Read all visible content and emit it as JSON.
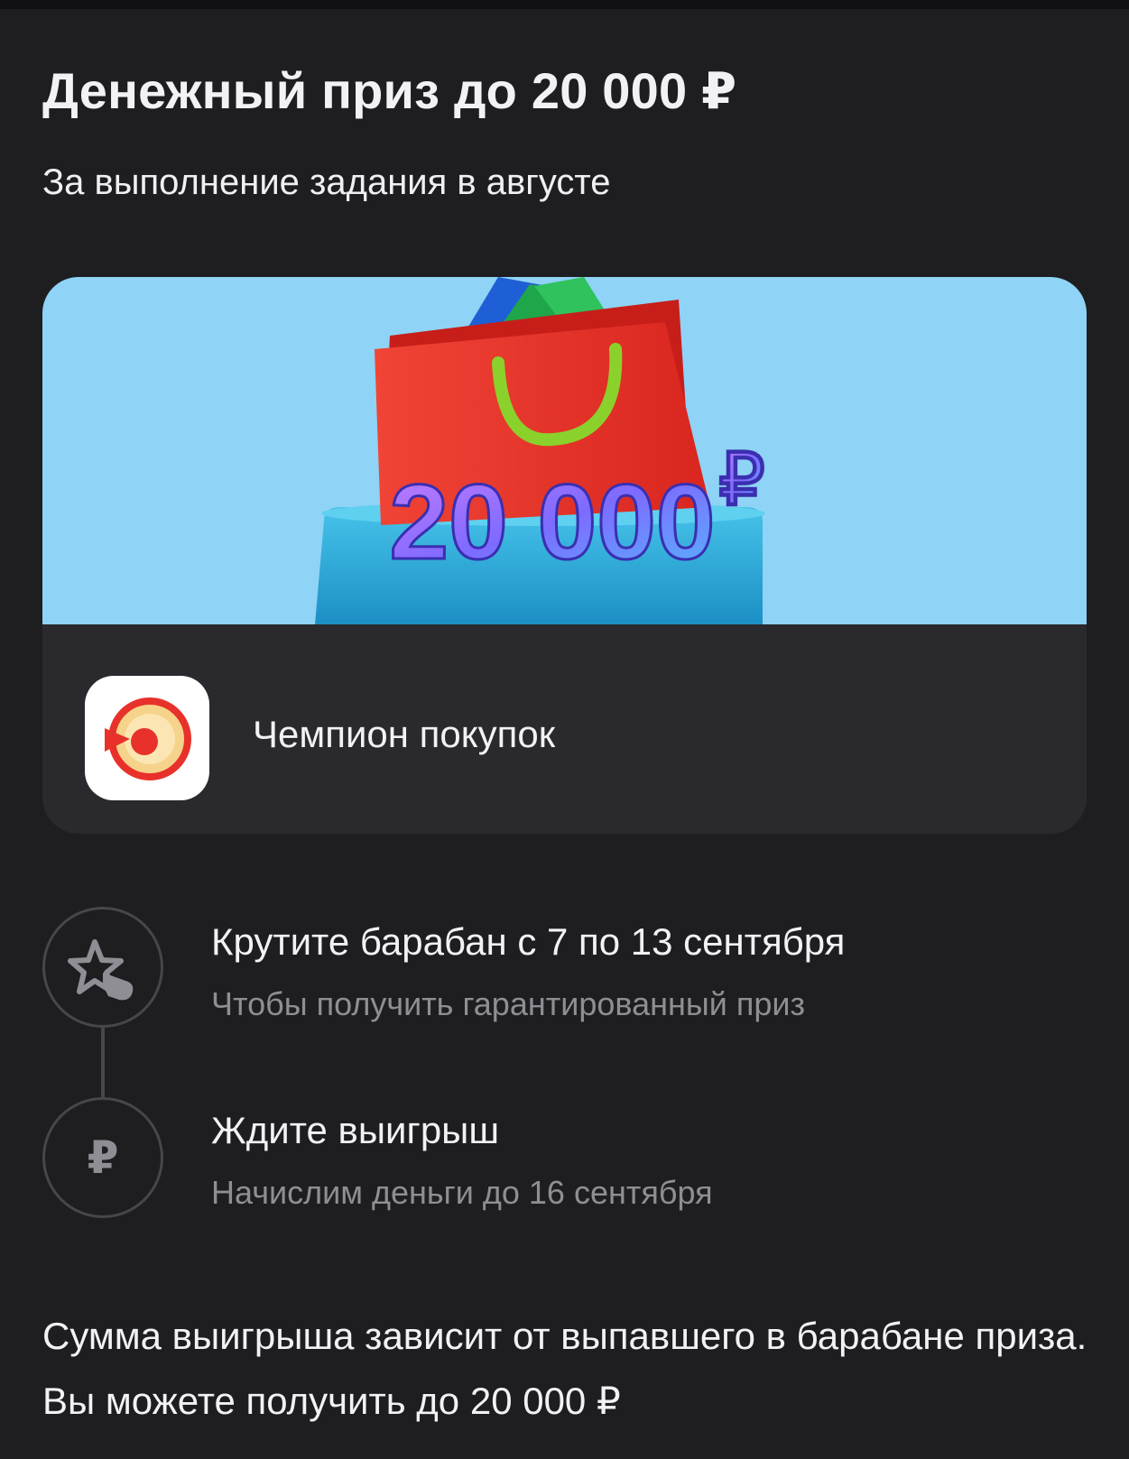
{
  "header": {
    "title": "Денежный приз до 20 000 ₽",
    "subtitle": "За выполнение задания в августе"
  },
  "promo": {
    "banner_amount": "20 000",
    "banner_currency": "₽",
    "app_name": "Чемпион покупок",
    "colors": {
      "banner_bg": "#8fd3f6",
      "bag": "#e8312a",
      "handle": "#8bd12c",
      "platform": "#2aa7d6"
    }
  },
  "steps": [
    {
      "title": "Крутите барабан с 7 по 13 сентября",
      "description": "Чтобы получить гарантированный приз",
      "icon": "star-tap-icon"
    },
    {
      "title": "Ждите выигрыш",
      "description": "Начислим деньги до 16 сентября",
      "icon": "ruble-icon",
      "glyph": "₽"
    }
  ],
  "footer": {
    "text": "Сумма выигрыша зависит от выпавшего в барабане приза. Вы можете получить до 20 000 ₽"
  }
}
